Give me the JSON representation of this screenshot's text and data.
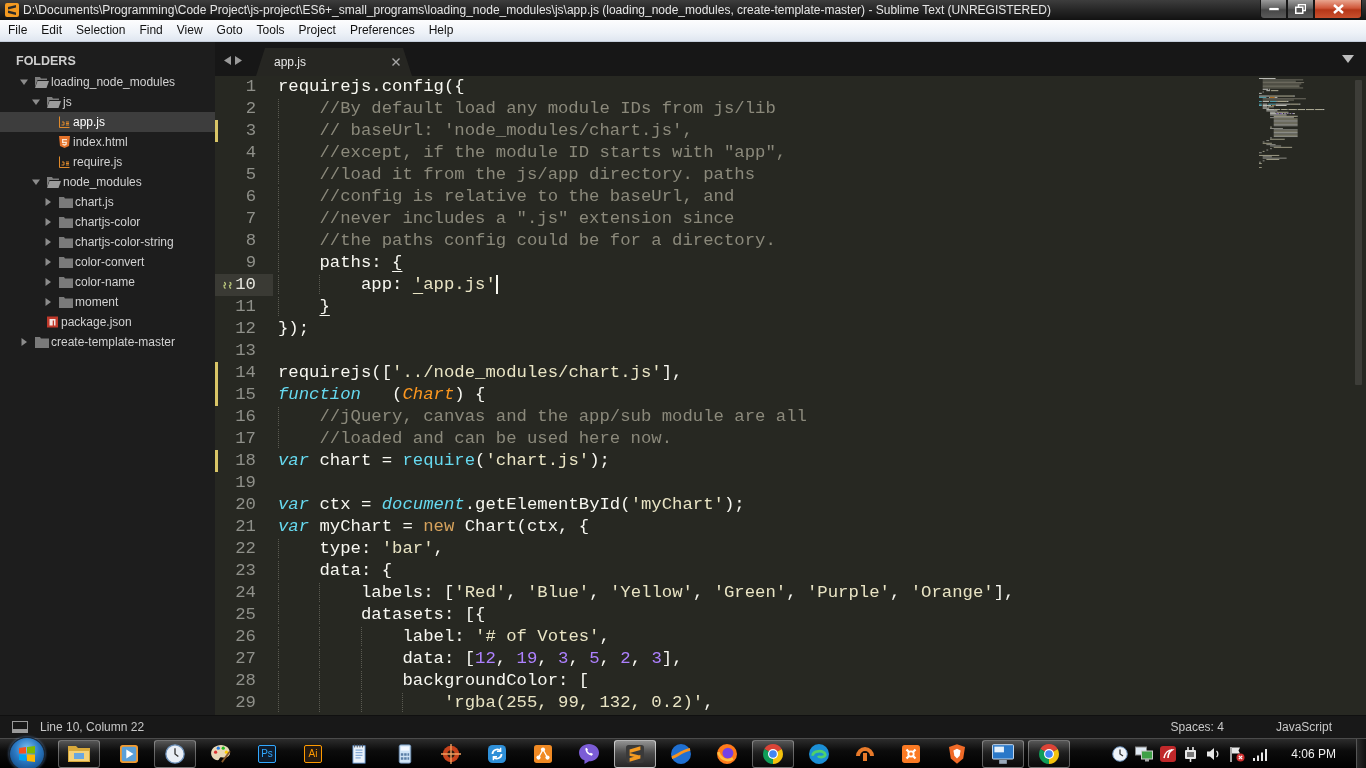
{
  "window": {
    "title": "D:\\Documents\\Programming\\Code Project\\js-project\\ES6+_small_programs\\loading_node_modules\\js\\app.js (loading_node_modules, create-template-master) - Sublime Text (UNREGISTERED)"
  },
  "menu_bar": [
    "File",
    "Edit",
    "Selection",
    "Find",
    "View",
    "Goto",
    "Tools",
    "Project",
    "Preferences",
    "Help"
  ],
  "sidebar": {
    "header": "FOLDERS",
    "tree": [
      {
        "label": "loading_node_modules",
        "kind": "folder",
        "expanded": true,
        "selected": false,
        "children": [
          {
            "label": "js",
            "kind": "folder",
            "expanded": true,
            "selected": false,
            "children": [
              {
                "label": "app.js",
                "kind": "js",
                "selected": true
              },
              {
                "label": "index.html",
                "kind": "html",
                "selected": false
              },
              {
                "label": "require.js",
                "kind": "js",
                "selected": false
              }
            ]
          },
          {
            "label": "node_modules",
            "kind": "folder",
            "expanded": true,
            "selected": false,
            "children": [
              {
                "label": "chart.js",
                "kind": "folder",
                "expanded": false,
                "selected": false
              },
              {
                "label": "chartjs-color",
                "kind": "folder",
                "expanded": false,
                "selected": false
              },
              {
                "label": "chartjs-color-string",
                "kind": "folder",
                "expanded": false,
                "selected": false
              },
              {
                "label": "color-convert",
                "kind": "folder",
                "expanded": false,
                "selected": false
              },
              {
                "label": "color-name",
                "kind": "folder",
                "expanded": false,
                "selected": false
              },
              {
                "label": "moment",
                "kind": "folder",
                "expanded": false,
                "selected": false
              }
            ]
          },
          {
            "label": "package.json",
            "kind": "json",
            "selected": false
          }
        ]
      },
      {
        "label": "create-template-master",
        "kind": "folder",
        "expanded": false,
        "selected": false
      }
    ]
  },
  "tabs": [
    {
      "label": "app.js",
      "selected": true
    }
  ],
  "editor": {
    "lines": [
      {
        "number": "1",
        "modified": false,
        "current": false,
        "bracket_mark": false,
        "tokens": [
          {
            "text": "requirejs.config({",
            "kind": "plain"
          }
        ]
      },
      {
        "number": "2",
        "modified": false,
        "current": false,
        "bracket_mark": false,
        "tokens": [
          {
            "text": "    //By default load any module IDs from js/lib",
            "kind": "comment"
          }
        ]
      },
      {
        "number": "3",
        "modified": true,
        "current": false,
        "bracket_mark": false,
        "tokens": [
          {
            "text": "    // baseUrl: 'node_modules/chart.js',",
            "kind": "comment"
          }
        ]
      },
      {
        "number": "4",
        "modified": false,
        "current": false,
        "bracket_mark": false,
        "tokens": [
          {
            "text": "    //except, if the module ID starts with \"app\",",
            "kind": "comment"
          }
        ]
      },
      {
        "number": "5",
        "modified": false,
        "current": false,
        "bracket_mark": false,
        "tokens": [
          {
            "text": "    //load it from the js/app directory. paths",
            "kind": "comment"
          }
        ]
      },
      {
        "number": "6",
        "modified": false,
        "current": false,
        "bracket_mark": false,
        "tokens": [
          {
            "text": "    //config is relative to the baseUrl, and",
            "kind": "comment"
          }
        ]
      },
      {
        "number": "7",
        "modified": false,
        "current": false,
        "bracket_mark": false,
        "tokens": [
          {
            "text": "    //never includes a \".js\" extension since",
            "kind": "comment"
          }
        ]
      },
      {
        "number": "8",
        "modified": false,
        "current": false,
        "bracket_mark": false,
        "tokens": [
          {
            "text": "    //the paths config could be for a directory.",
            "kind": "comment"
          }
        ]
      },
      {
        "number": "9",
        "modified": false,
        "current": false,
        "bracket_mark": false,
        "tokens": [
          {
            "text": "    paths: ",
            "kind": "plain"
          },
          {
            "text": "{",
            "kind": "matched"
          }
        ]
      },
      {
        "number": "10",
        "modified": false,
        "current": true,
        "bracket_mark": true,
        "tokens": [
          {
            "text": "        app: ",
            "kind": "plain"
          },
          {
            "text": "'",
            "kind": "matched-string"
          },
          {
            "text": "app.js'",
            "kind": "string"
          }
        ]
      },
      {
        "number": "11",
        "modified": false,
        "current": false,
        "bracket_mark": false,
        "tokens": [
          {
            "text": "    }",
            "kind": "matched"
          }
        ]
      },
      {
        "number": "12",
        "modified": false,
        "current": false,
        "bracket_mark": false,
        "tokens": [
          {
            "text": "});",
            "kind": "plain"
          }
        ]
      },
      {
        "number": "13",
        "modified": false,
        "current": false,
        "bracket_mark": false
      },
      {
        "number": "14",
        "modified": true,
        "current": false,
        "bracket_mark": false,
        "tokens": [
          {
            "text": "requirejs([",
            "kind": "plain"
          },
          {
            "text": "'../node_modules/chart.js'",
            "kind": "string"
          },
          {
            "text": "],",
            "kind": "plain"
          }
        ]
      },
      {
        "number": "15",
        "modified": true,
        "current": false,
        "bracket_mark": false,
        "tokens": [
          {
            "text": "function",
            "kind": "storage"
          },
          {
            "text": "   (",
            "kind": "plain"
          },
          {
            "text": "Chart",
            "kind": "param"
          },
          {
            "text": ") {",
            "kind": "plain"
          }
        ]
      },
      {
        "number": "16",
        "modified": false,
        "current": false,
        "bracket_mark": false,
        "tokens": [
          {
            "text": "    //jQuery, canvas and the app/sub module are all",
            "kind": "comment"
          }
        ]
      },
      {
        "number": "17",
        "modified": false,
        "current": false,
        "bracket_mark": false,
        "tokens": [
          {
            "text": "    //loaded and can be used here now.",
            "kind": "comment"
          }
        ]
      },
      {
        "number": "18",
        "modified": true,
        "current": false,
        "bracket_mark": false,
        "tokens": [
          {
            "text": "var",
            "kind": "storage"
          },
          {
            "text": " chart = ",
            "kind": "plain"
          },
          {
            "text": "require",
            "kind": "support"
          },
          {
            "text": "(",
            "kind": "plain"
          },
          {
            "text": "'chart.js'",
            "kind": "string"
          },
          {
            "text": ");",
            "kind": "plain"
          }
        ]
      },
      {
        "number": "19",
        "modified": false,
        "current": false,
        "bracket_mark": false
      },
      {
        "number": "20",
        "modified": false,
        "current": false,
        "bracket_mark": false,
        "tokens": [
          {
            "text": "var",
            "kind": "storage"
          },
          {
            "text": " ctx = ",
            "kind": "plain"
          },
          {
            "text": "document",
            "kind": "builtin"
          },
          {
            "text": ".getElementById(",
            "kind": "plain"
          },
          {
            "text": "'myChart'",
            "kind": "string"
          },
          {
            "text": ");",
            "kind": "plain"
          }
        ]
      },
      {
        "number": "21",
        "modified": false,
        "current": false,
        "bracket_mark": false,
        "tokens": [
          {
            "text": "var",
            "kind": "storage"
          },
          {
            "text": " myChart = ",
            "kind": "plain"
          },
          {
            "text": "new",
            "kind": "keyword"
          },
          {
            "text": " Chart(ctx, {",
            "kind": "plain"
          }
        ]
      },
      {
        "number": "22",
        "modified": false,
        "current": false,
        "bracket_mark": false,
        "tokens": [
          {
            "text": "    type: ",
            "kind": "plain"
          },
          {
            "text": "'bar'",
            "kind": "string"
          },
          {
            "text": ",",
            "kind": "plain"
          }
        ]
      },
      {
        "number": "23",
        "modified": false,
        "current": false,
        "bracket_mark": false,
        "tokens": [
          {
            "text": "    data: {",
            "kind": "plain"
          }
        ]
      },
      {
        "number": "24",
        "modified": false,
        "current": false,
        "bracket_mark": false,
        "tokens": [
          {
            "text": "        labels: [",
            "kind": "plain"
          },
          {
            "text": "'Red'",
            "kind": "string"
          },
          {
            "text": ", ",
            "kind": "plain"
          },
          {
            "text": "'Blue'",
            "kind": "string"
          },
          {
            "text": ", ",
            "kind": "plain"
          },
          {
            "text": "'Yellow'",
            "kind": "string"
          },
          {
            "text": ", ",
            "kind": "plain"
          },
          {
            "text": "'Green'",
            "kind": "string"
          },
          {
            "text": ", ",
            "kind": "plain"
          },
          {
            "text": "'Purple'",
            "kind": "string"
          },
          {
            "text": ", ",
            "kind": "plain"
          },
          {
            "text": "'Orange'",
            "kind": "string"
          },
          {
            "text": "],",
            "kind": "plain"
          }
        ]
      },
      {
        "number": "25",
        "modified": false,
        "current": false,
        "bracket_mark": false,
        "tokens": [
          {
            "text": "        datasets: [{",
            "kind": "plain"
          }
        ]
      },
      {
        "number": "26",
        "modified": false,
        "current": false,
        "bracket_mark": false,
        "tokens": [
          {
            "text": "            label: ",
            "kind": "plain"
          },
          {
            "text": "'# of Votes'",
            "kind": "string"
          },
          {
            "text": ",",
            "kind": "plain"
          }
        ]
      },
      {
        "number": "27",
        "modified": false,
        "current": false,
        "bracket_mark": false,
        "tokens": [
          {
            "text": "            data: [",
            "kind": "plain"
          },
          {
            "text": "12",
            "kind": "number"
          },
          {
            "text": ", ",
            "kind": "plain"
          },
          {
            "text": "19",
            "kind": "number"
          },
          {
            "text": ", ",
            "kind": "plain"
          },
          {
            "text": "3",
            "kind": "number"
          },
          {
            "text": ", ",
            "kind": "plain"
          },
          {
            "text": "5",
            "kind": "number"
          },
          {
            "text": ", ",
            "kind": "plain"
          },
          {
            "text": "2",
            "kind": "number"
          },
          {
            "text": ", ",
            "kind": "plain"
          },
          {
            "text": "3",
            "kind": "number"
          },
          {
            "text": "],",
            "kind": "plain"
          }
        ]
      },
      {
        "number": "28",
        "modified": false,
        "current": false,
        "bracket_mark": false,
        "tokens": [
          {
            "text": "            backgroundColor: [",
            "kind": "plain"
          }
        ]
      },
      {
        "number": "29",
        "modified": false,
        "current": false,
        "bracket_mark": false,
        "tokens": [
          {
            "text": "                'rgba(255, 99, 132, 0.2)'",
            "kind": "string"
          },
          {
            "text": ",",
            "kind": "plain"
          }
        ]
      }
    ]
  },
  "status_bar": {
    "position": "Line 10, Column 22",
    "indentation": "Spaces: 4",
    "syntax": "JavaScript"
  },
  "taskbar": {
    "apps": [
      {
        "kind": "folder",
        "running": true,
        "selected": false
      },
      {
        "kind": "player",
        "running": false,
        "selected": false
      },
      {
        "kind": "clock",
        "running": true,
        "selected": false
      },
      {
        "kind": "palette",
        "running": false,
        "selected": false
      },
      {
        "kind": "tile",
        "label": "Ps",
        "color": "#31a8ff",
        "running": false,
        "selected": false
      },
      {
        "kind": "tile",
        "label": "Ai",
        "color": "#ff9a00",
        "running": false,
        "selected": false
      },
      {
        "kind": "notepad",
        "running": false,
        "selected": false
      },
      {
        "kind": "calculator",
        "running": false,
        "selected": false
      },
      {
        "kind": "crosshair",
        "running": false,
        "selected": false
      },
      {
        "kind": "sync",
        "running": false,
        "selected": false
      },
      {
        "kind": "nodes",
        "running": false,
        "selected": false
      },
      {
        "kind": "chat",
        "running": false,
        "selected": false
      },
      {
        "kind": "editor",
        "running": true,
        "selected": true
      },
      {
        "kind": "globe",
        "running": false,
        "selected": false
      },
      {
        "kind": "fox",
        "running": false,
        "selected": false
      },
      {
        "kind": "wheel",
        "running": true,
        "selected": false
      },
      {
        "kind": "swirl",
        "running": false,
        "selected": false
      },
      {
        "kind": "arc",
        "running": false,
        "selected": false
      },
      {
        "kind": "cross-tile",
        "running": false,
        "selected": false
      },
      {
        "kind": "shield",
        "running": false,
        "selected": false
      },
      {
        "kind": "monitor",
        "running": true,
        "selected": false
      },
      {
        "kind": "wheel",
        "running": true,
        "selected": false
      }
    ],
    "clock": "4:06 PM"
  }
}
